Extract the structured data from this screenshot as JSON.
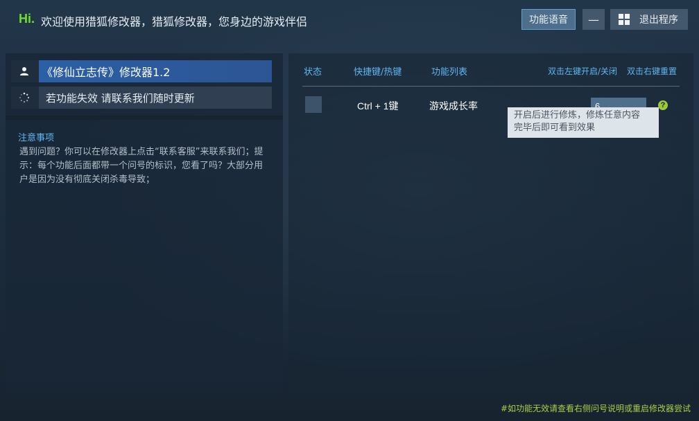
{
  "header": {
    "hi": "Hi.",
    "greeting": "欢迎使用猎狐修改器，猎狐修改器，您身边的游戏伴侣",
    "voice_button": "功能语音",
    "minimize_button": "—",
    "exit_button": "退出程序"
  },
  "left_panel": {
    "title": "《修仙立志传》修改器1.2",
    "notice": "若功能失效  请联系我们随时更新",
    "tips_title": "注意事项",
    "tips_body": "遇到问题？你可以在修改器上点击“联系客服”来联系我们；提示：每个功能后面都带一个问号的标识，您看了吗？大部分用户是因为没有彻底关闭杀毒导致；"
  },
  "table": {
    "headers": {
      "status": "状态",
      "hotkey": "快捷键/热键",
      "feature_list": "功能列表",
      "left_click": "双击左键开启/关闭",
      "right_click": "双击右键重置"
    },
    "rows": [
      {
        "hotkey": "Ctrl + 1键",
        "feature": "游戏成长率",
        "value": "6",
        "help": "?"
      }
    ]
  },
  "tooltip": {
    "line1": "开启后进行修炼，修炼任意内容",
    "line2": "完毕后即可看到效果"
  },
  "footer": "#如功能无效请查看右侧问号说明或重启修改器尝试",
  "colors": {
    "accent_green": "#6ee02e",
    "header_blue": "#5fb6ef",
    "title_bar": "#2b5fa6",
    "footer_text": "#a8d04a"
  }
}
